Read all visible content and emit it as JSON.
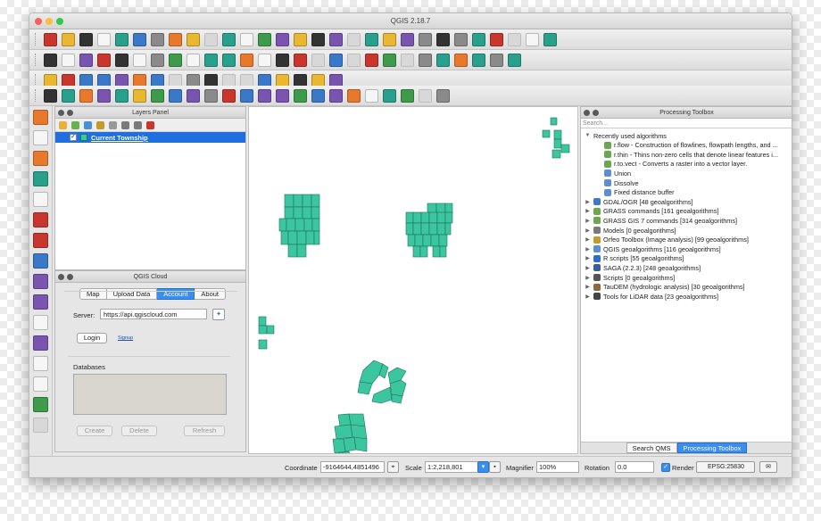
{
  "window": {
    "title": "QGIS 2.18.7"
  },
  "colors": {
    "accent": "#3a8ef0",
    "feature_fill": "#3cc6a0",
    "feature_stroke": "#1d6f5c",
    "selection": "#1f6fe0"
  },
  "toolbar_icons": {
    "row1": [
      "new-project-icon",
      "open-project-icon",
      "save-project-icon",
      "save-as-icon",
      "new-print-composer-icon",
      "composer-manager-icon",
      "pan-icon",
      "pan-to-selection-icon",
      "zoom-in-icon",
      "zoom-out-icon",
      "zoom-full-icon",
      "zoom-to-selection-icon",
      "zoom-to-layer-icon",
      "zoom-native-icon",
      "zoom-last-icon",
      "zoom-next-icon",
      "new-map-view-icon",
      "refresh-icon",
      "identify-icon",
      "measure-icon",
      "select-icon",
      "deselect-icon",
      "attribute-table-icon",
      "field-calculator-icon",
      "statistics-icon",
      "measure-line-icon",
      "annotation-icon",
      "text-annotation-icon",
      "help-icon"
    ],
    "row2": [
      "edit-icon",
      "save-edits-icon",
      "add-feature-icon",
      "move-feature-icon",
      "node-tool-icon",
      "delete-selected-icon",
      "cut-icon",
      "copy-icon",
      "paste-icon",
      "label-icon",
      "pin-label-icon",
      "show-label-icon",
      "move-label-icon",
      "rotate-label-icon",
      "change-label-icon",
      "db-manager-icon",
      "globe-icon",
      "browser-icon",
      "python-icon",
      "plugin-a-icon",
      "plugin-b-icon",
      "plugin-c-icon",
      "georeferencer-icon",
      "gps-icon",
      "processing-icon",
      "search-plugin-icon",
      "network-icon"
    ],
    "row3": [
      "digitize-icon",
      "undo-icon",
      "redo-icon",
      "simplify-icon",
      "add-ring-icon",
      "add-part-icon",
      "fill-ring-icon",
      "delete-ring-icon",
      "delete-part-icon",
      "reshape-icon",
      "offset-curve-icon",
      "split-icon",
      "split-parts-icon",
      "merge-icon",
      "merge-attributes-icon",
      "rotate-symbol-icon",
      "rotate-point-icon"
    ],
    "row4": [
      "snap-icon",
      "vertex-icon",
      "segment-icon",
      "grid-icon",
      "checker-icon",
      "square-icon",
      "north-arrow-icon",
      "north-arrow-2-icon",
      "north-arrow-3-icon",
      "info-icon",
      "add-wms-icon",
      "add-wfs-icon",
      "add-wcs-icon",
      "layer-group-icon",
      "label-tool-icon",
      "label-tool-2-icon",
      "label-tool-3-icon",
      "label-tool-4-icon",
      "label-tool-5-icon",
      "label-tool-6-icon",
      "label-tool-7-icon",
      "label-tool-8-icon",
      "label-tool-9-icon"
    ]
  },
  "left_toolbar_icons": [
    "add-vector-icon",
    "add-raster-icon",
    "add-delimited-text-icon",
    "add-spatialite-icon",
    "add-postgis-icon",
    "add-mssql-icon",
    "add-wms-layer-icon",
    "add-wcs-layer-icon",
    "add-wfs-layer-icon",
    "add-virtual-layer-icon",
    "new-shapefile-icon",
    "new-spatialite-icon",
    "add-oracle-icon",
    "add-wms-server-icon",
    "add-arcgis-icon",
    "qgis-cloud-icon"
  ],
  "layers_panel": {
    "title": "Layers Panel",
    "layer": {
      "name": "Current Township",
      "checked": "✓"
    }
  },
  "cloud_panel": {
    "title": "QGIS Cloud",
    "tabs": [
      "Map",
      "Upload Data",
      "Account",
      "About"
    ],
    "active_tab": "Account",
    "server_label": "Server:",
    "server_value": "https://api.qgiscloud.com",
    "login_label": "Login",
    "signup_label": "Signup",
    "databases_label": "Databases",
    "create_label": "Create",
    "delete_label": "Delete",
    "refresh_label": "Refresh"
  },
  "processing_toolbox": {
    "title": "Processing Toolbox",
    "search_placeholder": "Search...",
    "rows": [
      {
        "label": "Recently used algorithms",
        "expanded": true,
        "icon": "none"
      },
      {
        "label": "r.flow - Construction of flowlines, flowpath lengths, and ...",
        "indent": 1,
        "icon": "grass-icon"
      },
      {
        "label": "r.thin - Thins non-zero cells that denote linear features i...",
        "indent": 1,
        "icon": "grass-icon"
      },
      {
        "label": "r.to.vect - Converts a raster into a vector layer.",
        "indent": 1,
        "icon": "grass-icon"
      },
      {
        "label": "Union",
        "indent": 1,
        "icon": "qgis-icon"
      },
      {
        "label": "Dissolve",
        "indent": 1,
        "icon": "qgis-icon"
      },
      {
        "label": "Fixed distance buffer",
        "indent": 1,
        "icon": "qgis-icon"
      },
      {
        "label": "GDAL/OGR [48 geoalgorithms]",
        "icon": "gdal-icon"
      },
      {
        "label": "GRASS commands [161 geoalgorithms]",
        "icon": "grass-icon"
      },
      {
        "label": "GRASS GIS 7 commands [314 geoalgorithms]",
        "icon": "grass-icon"
      },
      {
        "label": "Models [0 geoalgorithms]",
        "icon": "models-icon"
      },
      {
        "label": "Orfeo Toolbox (Image analysis) [99 geoalgorithms]",
        "icon": "orfeo-icon"
      },
      {
        "label": "QGIS geoalgorithms [116 geoalgorithms]",
        "icon": "qgis-icon"
      },
      {
        "label": "R scripts [55 geoalgorithms]",
        "icon": "r-icon"
      },
      {
        "label": "SAGA (2.2.3) [248 geoalgorithms]",
        "icon": "saga-icon"
      },
      {
        "label": "Scripts [0 geoalgorithms]",
        "icon": "scripts-icon"
      },
      {
        "label": "TauDEM (hydrologic analysis) [30 geoalgorithms]",
        "icon": "taudem-icon"
      },
      {
        "label": "Tools for LiDAR data [23 geoalgorithms]",
        "icon": "lidar-icon"
      }
    ],
    "bottom_tabs": [
      "Search QMS",
      "Processing Toolbox"
    ],
    "active_bottom_tab": "Processing Toolbox"
  },
  "statusbar": {
    "coordinate_label": "Coordinate",
    "coordinate_value": "-9164644,4851496",
    "scale_label": "Scale",
    "scale_value": "1:2,218,801",
    "magnifier_label": "Magnifier",
    "magnifier_value": "100%",
    "rotation_label": "Rotation",
    "rotation_value": "0.0",
    "render_label": "Render",
    "render_checked": "✓",
    "crs_label": "EPSG:25830"
  }
}
